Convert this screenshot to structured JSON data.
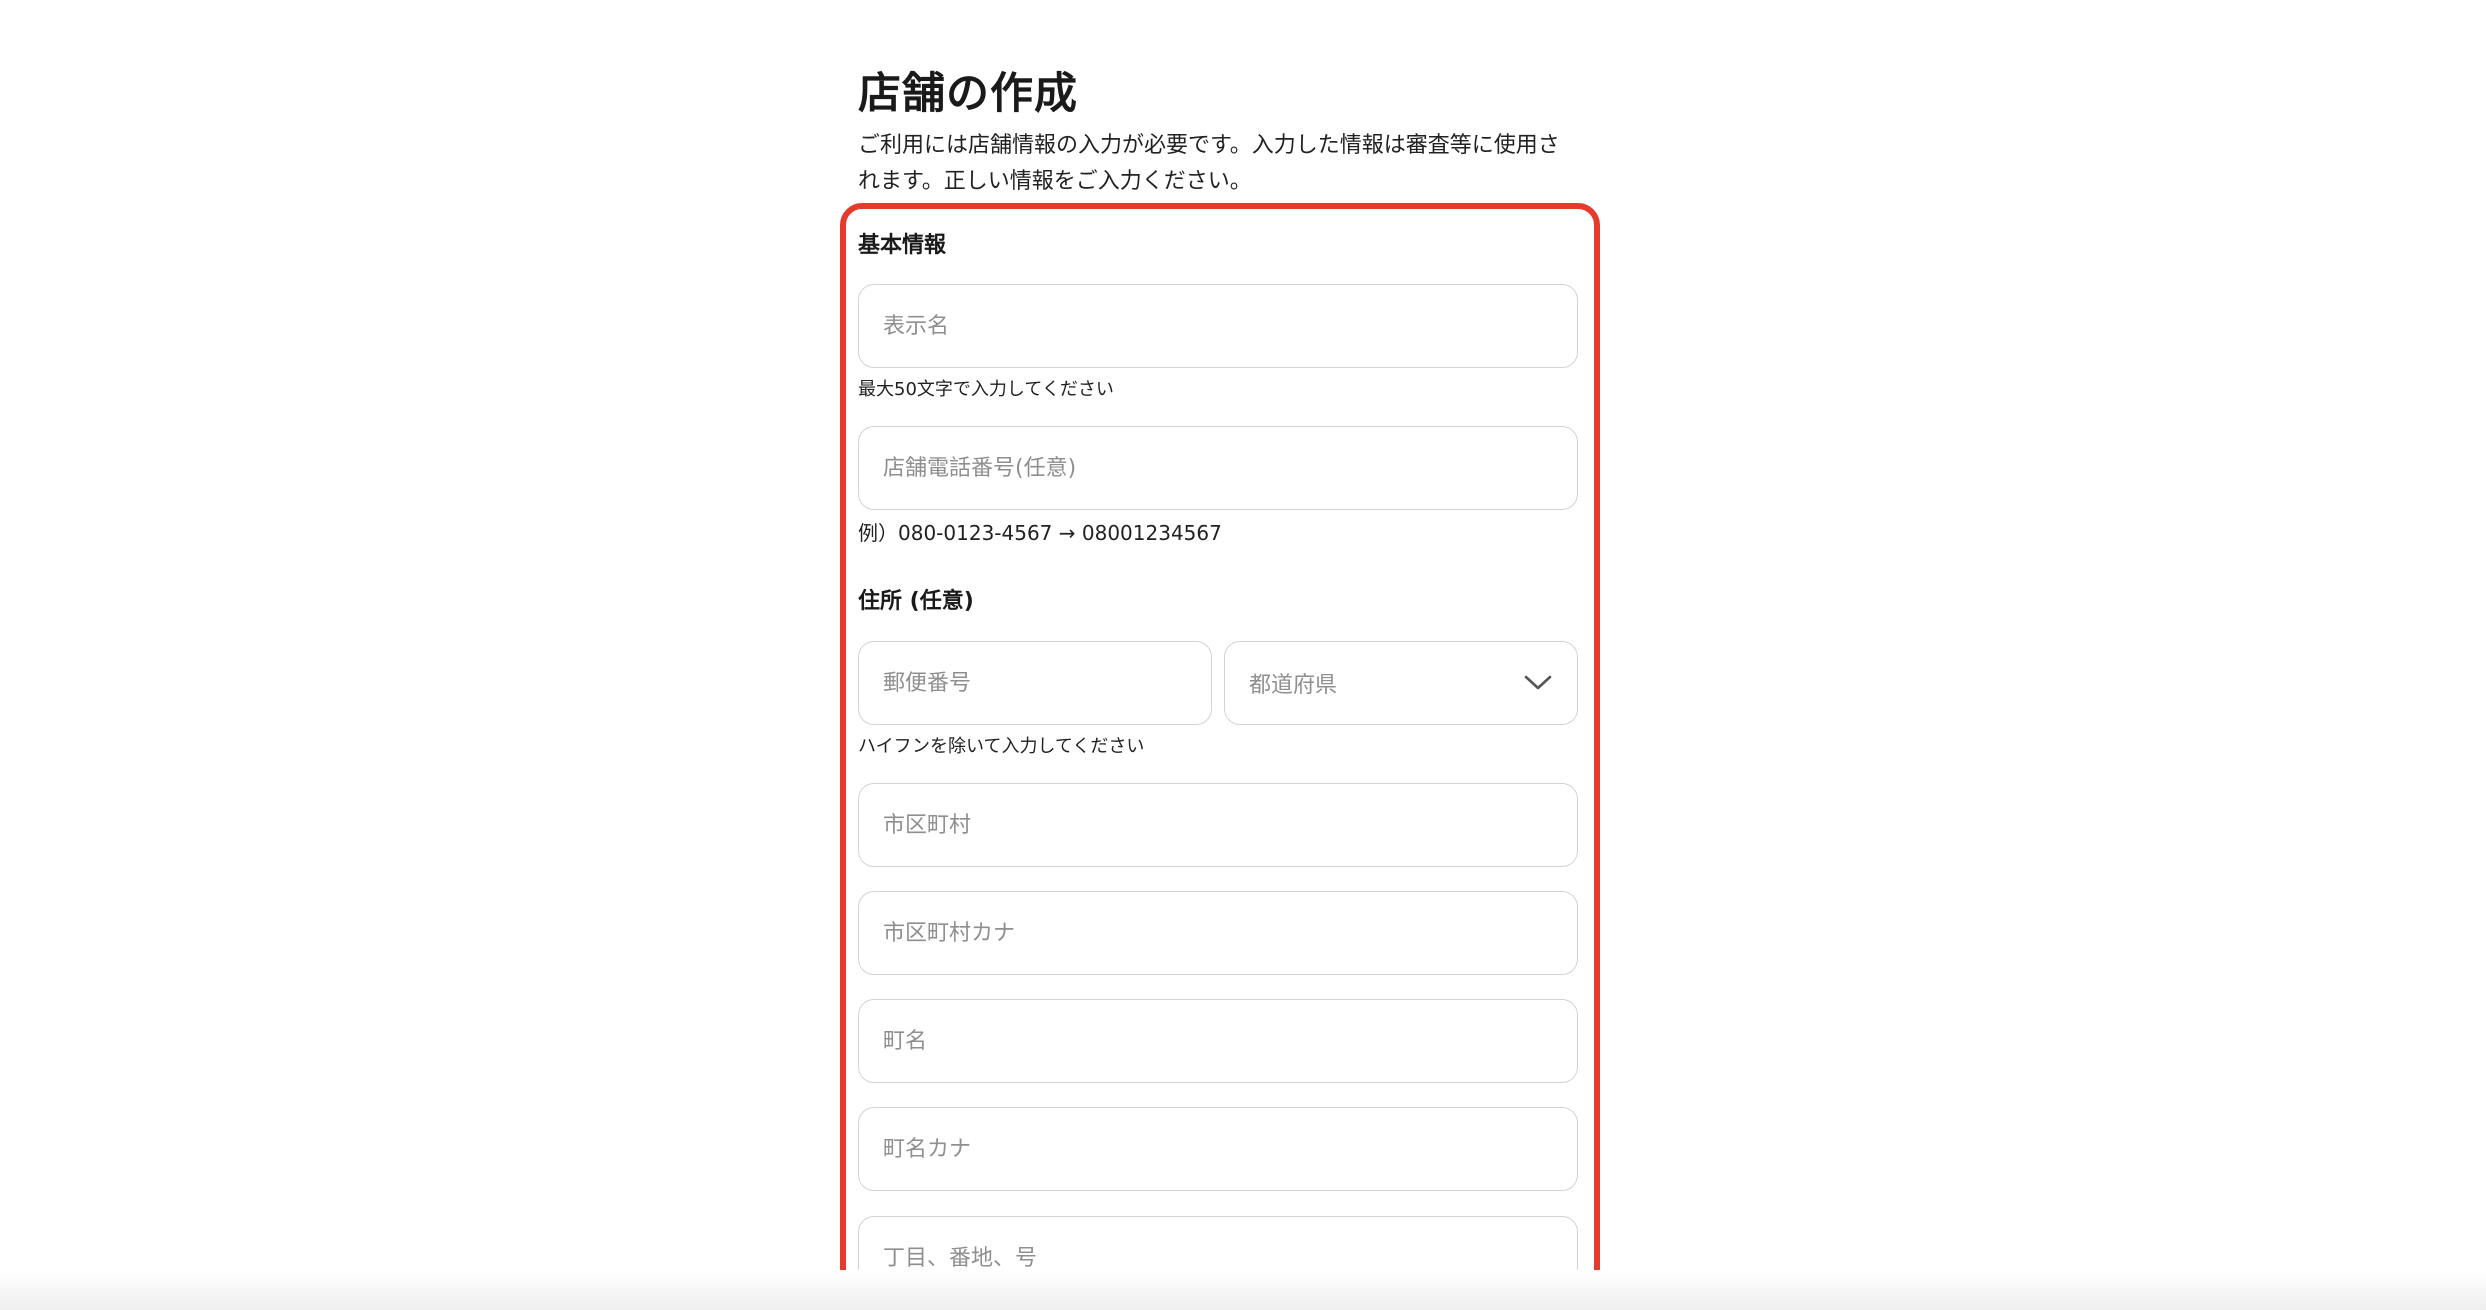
{
  "header": {
    "title": "店舗の作成",
    "description": "ご利用には店舗情報の入力が必要です。入力した情報は審査等に使用されます。正しい情報をご入力ください。"
  },
  "basic_info": {
    "section_title": "基本情報",
    "display_name": {
      "placeholder": "表示名",
      "value": "",
      "hint": "最大50文字で入力してください"
    },
    "phone": {
      "placeholder": "店舗電話番号(任意)",
      "value": "",
      "hint": "例）080-0123-4567 → 08001234567"
    }
  },
  "address": {
    "section_title": "住所 (任意)",
    "postal_code": {
      "placeholder": "郵便番号",
      "value": "",
      "hint": "ハイフンを除いて入力してください"
    },
    "prefecture": {
      "selected": "都道府県",
      "icon": "chevron-down-icon"
    },
    "city": {
      "placeholder": "市区町村",
      "value": ""
    },
    "city_kana": {
      "placeholder": "市区町村カナ",
      "value": ""
    },
    "town": {
      "placeholder": "町名",
      "value": ""
    },
    "town_kana": {
      "placeholder": "町名カナ",
      "value": ""
    },
    "block": {
      "placeholder": "丁目、番地、号",
      "value": ""
    }
  },
  "colors": {
    "highlight_border": "#e53b2c",
    "field_border": "#d3d3d3",
    "placeholder": "#8f8f8f"
  }
}
